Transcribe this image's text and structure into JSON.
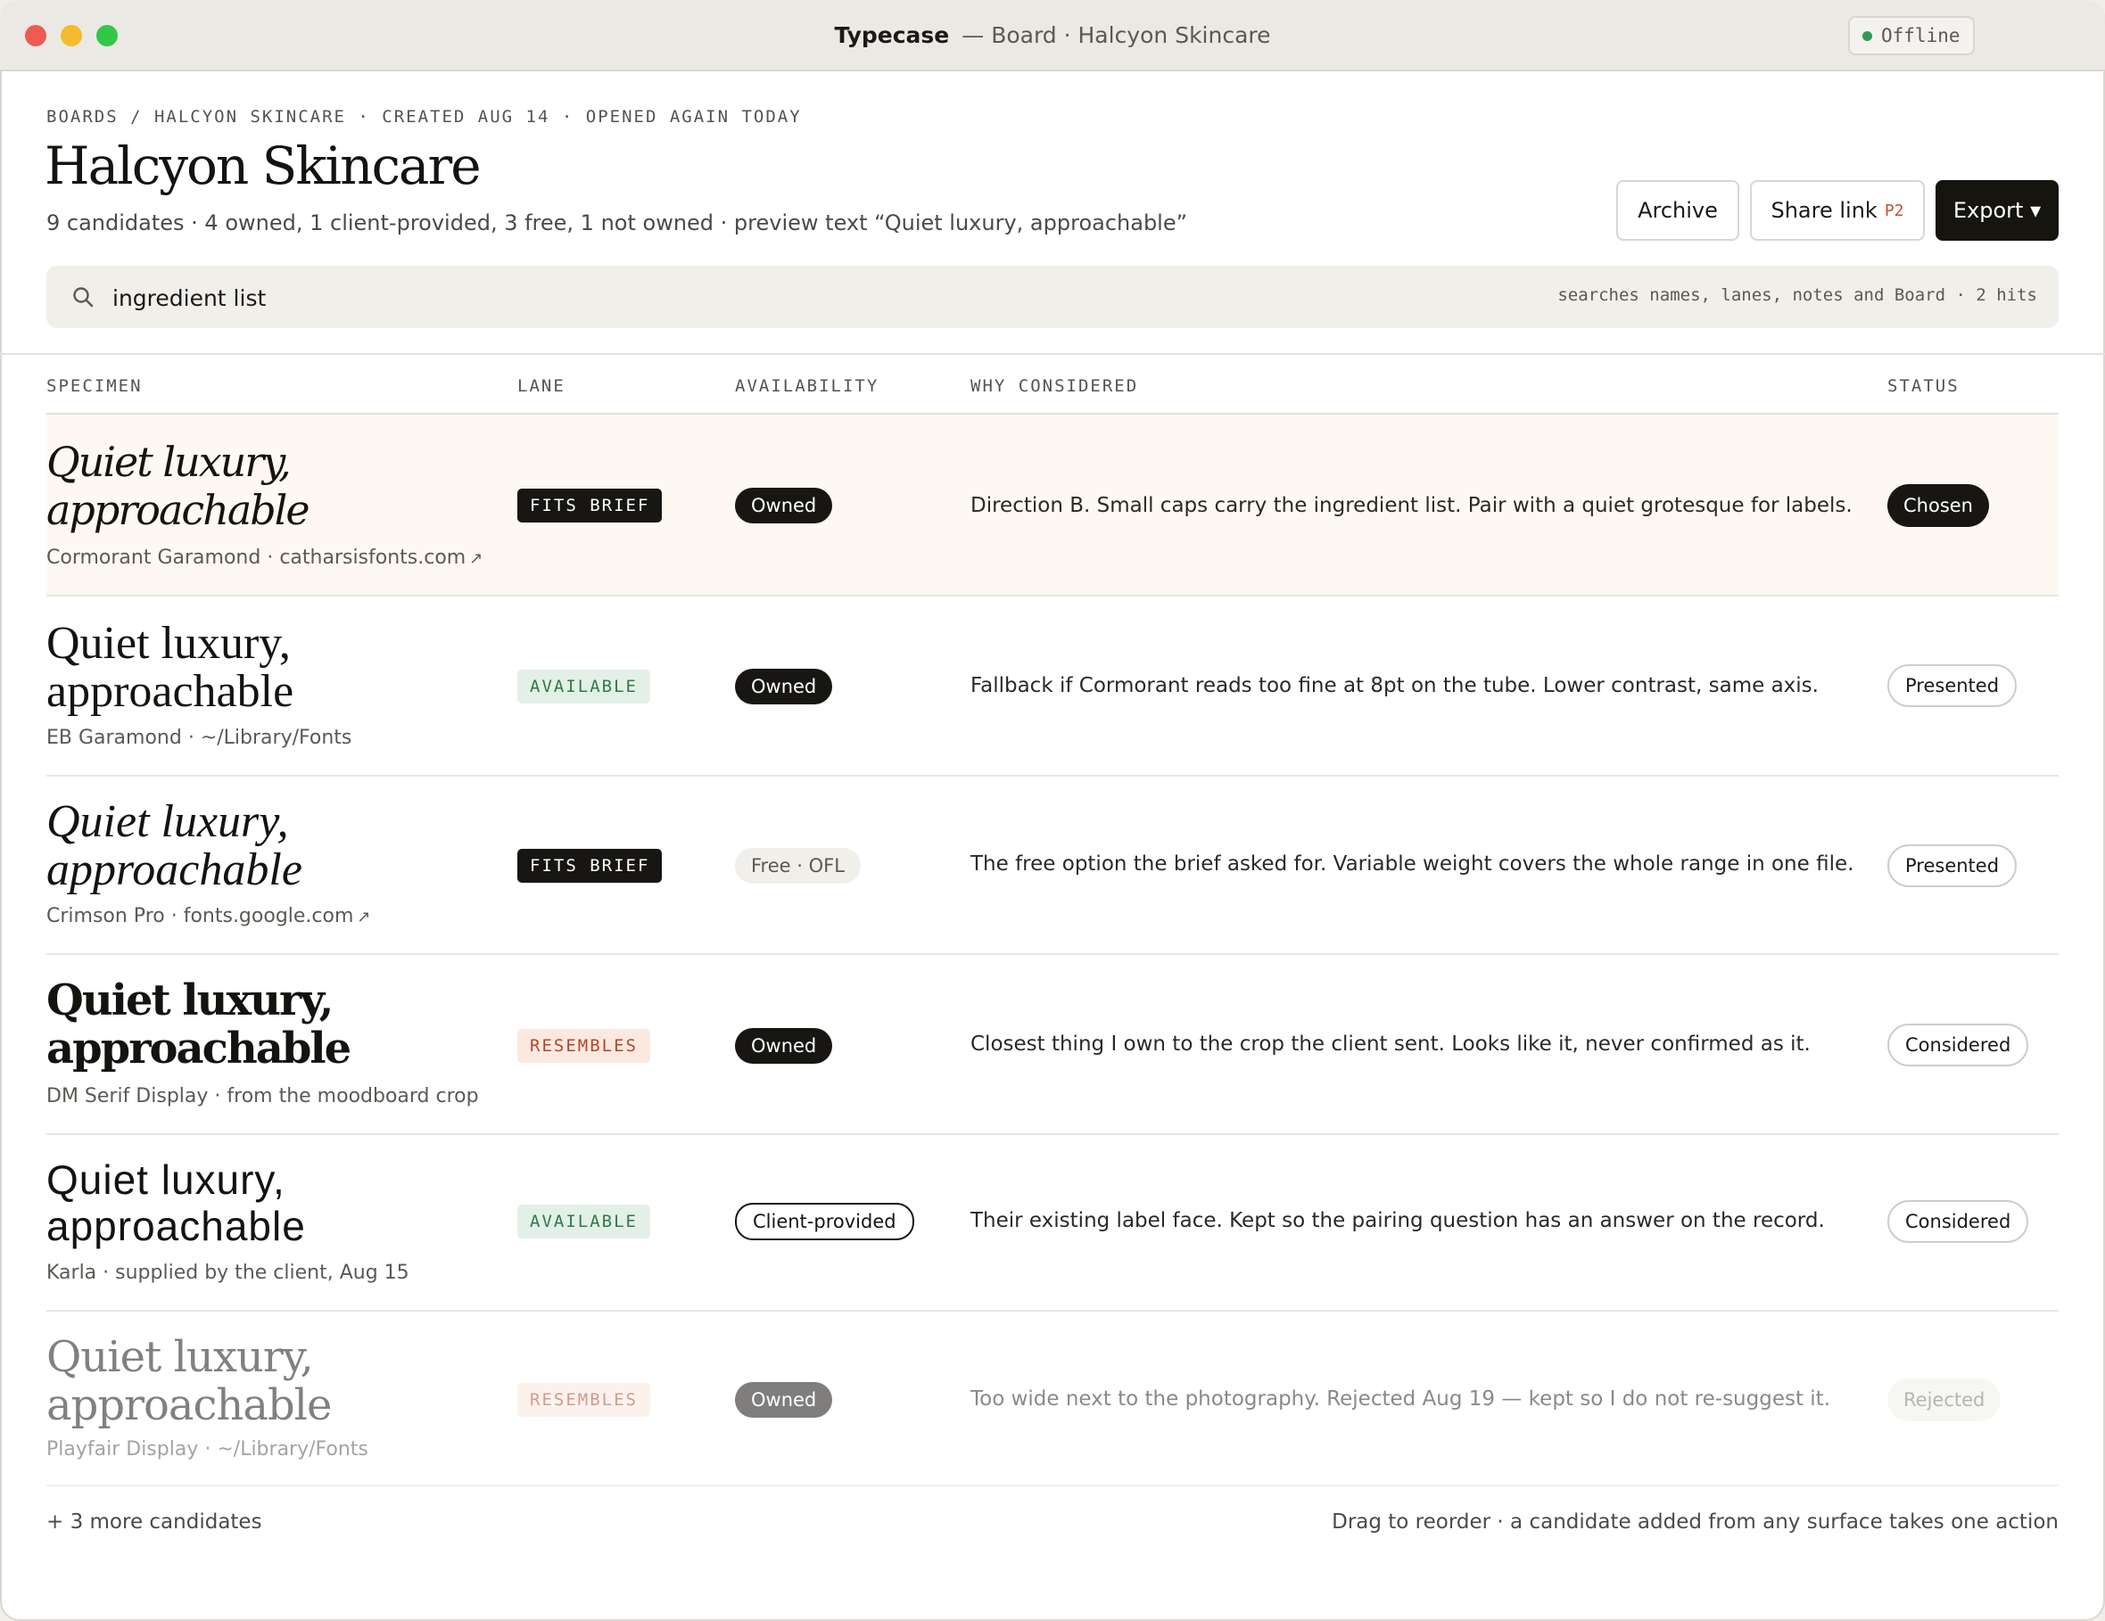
{
  "window": {
    "app_name": "Typecase",
    "subtitle": "— Board · Halcyon Skincare",
    "offline_label": "Offline",
    "colors": {
      "offline_dot": "#2e9b4e",
      "accent_dark": "#15140f",
      "share_tag": "#c9502b"
    }
  },
  "header": {
    "breadcrumb": "BOARDS / HALCYON SKINCARE · CREATED AUG 14 · OPENED AGAIN TODAY",
    "title": "Halcyon Skincare",
    "summary": "9 candidates · 4 owned, 1 client-provided, 3 free, 1 not owned · preview text “Quiet luxury, approachable”",
    "buttons": {
      "archive": "Archive",
      "share": "Share link",
      "share_tag": "P2",
      "export": "Export ▾"
    }
  },
  "search": {
    "value": "ingredient list",
    "hint": "searches names, lanes, notes and Board · 2 hits",
    "icon": "search-icon"
  },
  "table": {
    "headers": {
      "specimen": "SPECIMEN",
      "lane": "LANE",
      "availability": "AVAILABILITY",
      "why": "WHY CONSIDERED",
      "status": "STATUS"
    },
    "rows": [
      {
        "specimen": "Quiet luxury, approachable",
        "font_name": "Cormorant Garamond",
        "source": "catharsisfonts.com",
        "source_link": true,
        "lane": "FITS BRIEF",
        "availability": "Owned",
        "why": "Direction B. Small caps carry the ingredient list. Pair with a quiet grotesque for labels.",
        "status": "Chosen"
      },
      {
        "specimen": "Quiet luxury, approachable",
        "font_name": "EB Garamond",
        "source": "~/Library/Fonts",
        "source_link": false,
        "lane": "AVAILABLE",
        "availability": "Owned",
        "why": "Fallback if Cormorant reads too fine at 8pt on the tube. Lower contrast, same axis.",
        "status": "Presented"
      },
      {
        "specimen": "Quiet luxury, approachable",
        "font_name": "Crimson Pro",
        "source": "fonts.google.com",
        "source_link": true,
        "lane": "FITS BRIEF",
        "availability": "Free · OFL",
        "why": "The free option the brief asked for. Variable weight covers the whole range in one file.",
        "status": "Presented"
      },
      {
        "specimen": "Quiet luxury, approachable",
        "font_name": "DM Serif Display",
        "source": "from the moodboard crop",
        "source_link": false,
        "lane": "RESEMBLES",
        "availability": "Owned",
        "why": "Closest thing I own to the crop the client sent. Looks like it, never confirmed as it.",
        "status": "Considered"
      },
      {
        "specimen": "Quiet luxury, approachable",
        "font_name": "Karla",
        "source": "supplied by the client, Aug 15",
        "source_link": false,
        "lane": "AVAILABLE",
        "availability": "Client-provided",
        "why": "Their existing label face. Kept so the pairing question has an answer on the record.",
        "status": "Considered"
      },
      {
        "specimen": "Quiet luxury, approachable",
        "font_name": "Playfair Display",
        "source": "~/Library/Fonts",
        "source_link": false,
        "lane": "RESEMBLES",
        "availability": "Owned",
        "why": "Too wide next to the photography. Rejected Aug 19 — kept so I do not re-suggest it.",
        "status": "Rejected"
      }
    ]
  },
  "footer": {
    "more": "+ 3 more candidates",
    "hint": "Drag to reorder · a candidate added from any surface takes one action"
  }
}
